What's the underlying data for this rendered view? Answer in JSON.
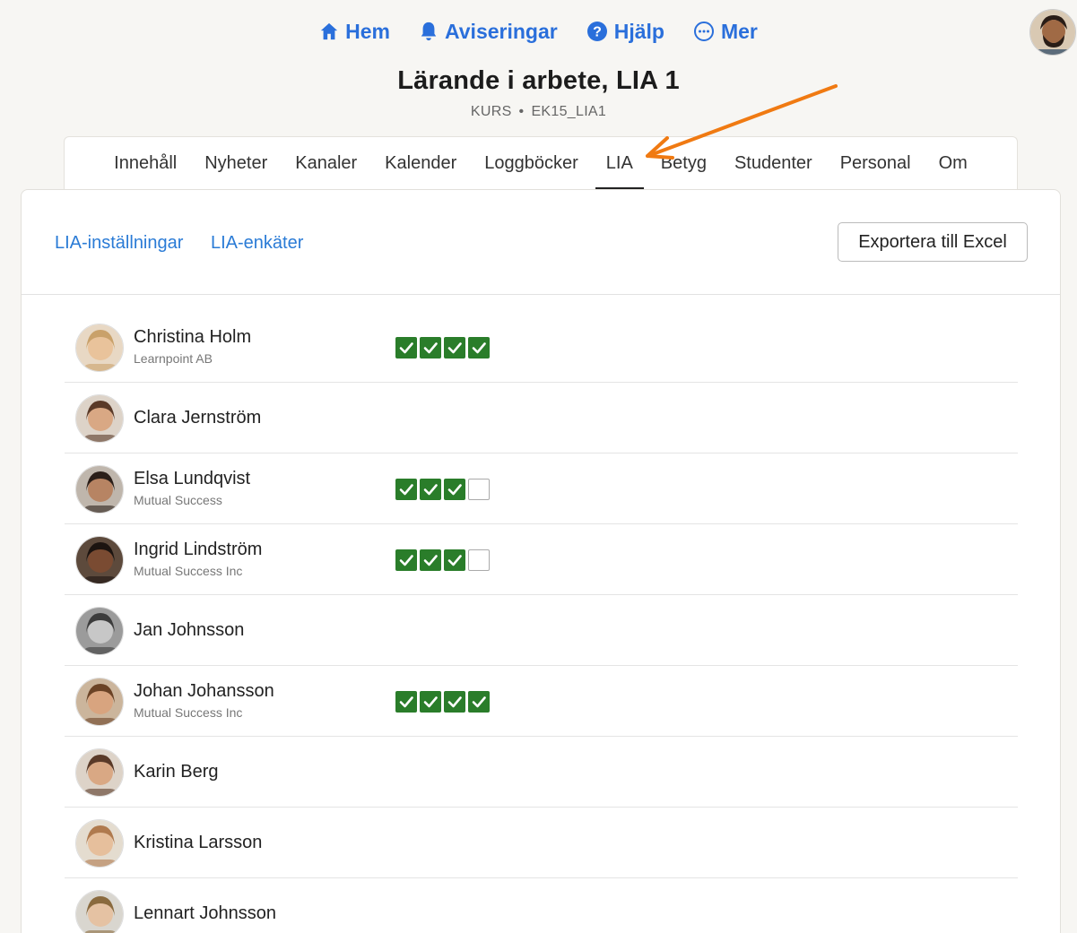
{
  "topnav": [
    {
      "label": "Hem",
      "icon": "home-icon"
    },
    {
      "label": "Aviseringar",
      "icon": "bell-icon"
    },
    {
      "label": "Hjälp",
      "icon": "help-icon"
    },
    {
      "label": "Mer",
      "icon": "more-icon"
    }
  ],
  "course": {
    "title": "Lärande i arbete, LIA 1",
    "type": "KURS",
    "code": "EK15_LIA1"
  },
  "tabs": [
    "Innehåll",
    "Nyheter",
    "Kanaler",
    "Kalender",
    "Loggböcker",
    "LIA",
    "Betyg",
    "Studenter",
    "Personal",
    "Om"
  ],
  "active_tab": "LIA",
  "subnav": {
    "settings": "LIA-inställningar",
    "surveys": "LIA-enkäter",
    "export": "Exportera till Excel"
  },
  "students": [
    {
      "name": "Christina Holm",
      "company": "Learnpoint AB",
      "checks": [
        true,
        true,
        true,
        true
      ]
    },
    {
      "name": "Clara Jernström",
      "company": "",
      "checks": []
    },
    {
      "name": "Elsa Lundqvist",
      "company": "Mutual Success",
      "checks": [
        true,
        true,
        true,
        false
      ]
    },
    {
      "name": "Ingrid Lindström",
      "company": "Mutual Success Inc",
      "checks": [
        true,
        true,
        true,
        false
      ]
    },
    {
      "name": "Jan Johnsson",
      "company": "",
      "checks": []
    },
    {
      "name": "Johan Johansson",
      "company": "Mutual Success Inc",
      "checks": [
        true,
        true,
        true,
        true
      ]
    },
    {
      "name": "Karin Berg",
      "company": "",
      "checks": []
    },
    {
      "name": "Kristina Larsson",
      "company": "",
      "checks": []
    },
    {
      "name": "Lennart Johnsson",
      "company": "",
      "checks": []
    }
  ],
  "colors": {
    "link": "#2a6fdb",
    "check_on": "#2a7d2a",
    "arrow": "#f07a12"
  }
}
